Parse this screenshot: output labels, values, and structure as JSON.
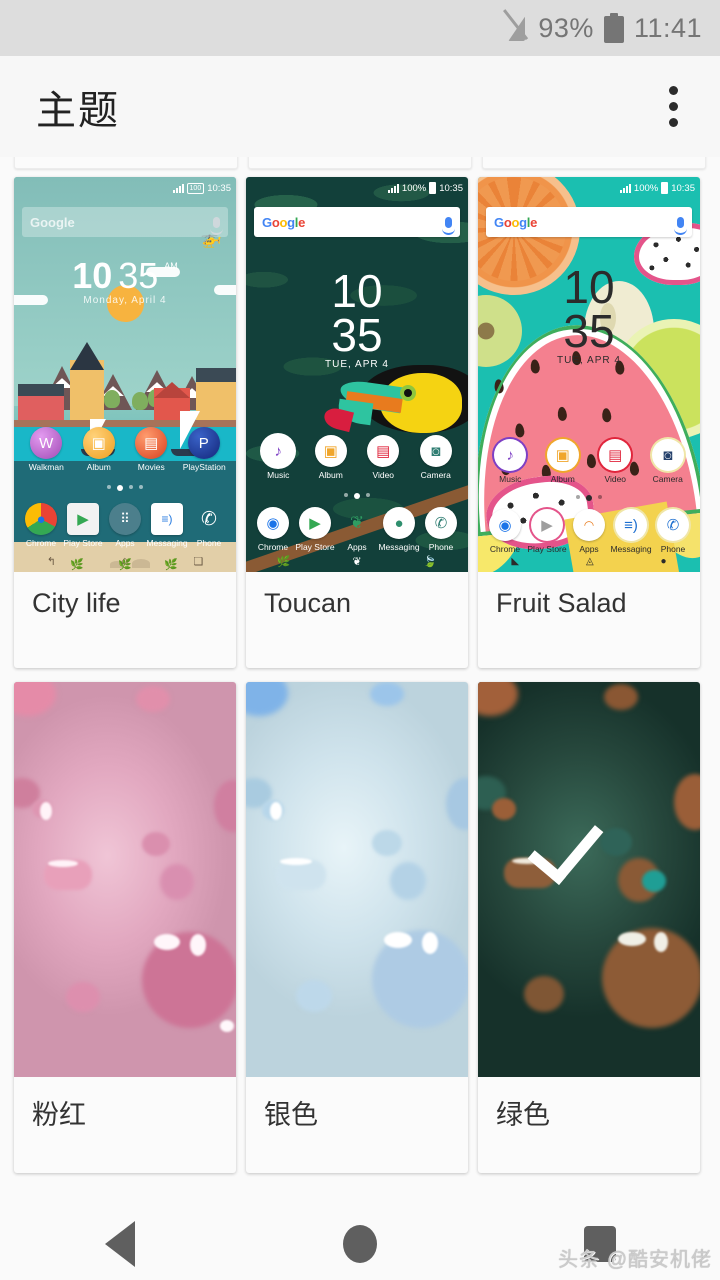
{
  "statusbar": {
    "signal_icon": "signal-off-icon",
    "battery_percent": "93%",
    "battery_icon": "battery-icon",
    "time": "11:41"
  },
  "appbar": {
    "title": "主题",
    "overflow_icon": "overflow-menu-icon"
  },
  "navbar": {
    "back_icon": "back-triangle-icon",
    "home_icon": "home-circle-icon",
    "recents_icon": "recents-square-icon"
  },
  "watermark": "头条 @酷安机佬",
  "mini_status": {
    "time": "10:35",
    "battery_text_100": "100",
    "battery_percent_100": "100%"
  },
  "themes": [
    {
      "label": "City life",
      "selected": false,
      "clock_line1": "10",
      "clock_line2": "35",
      "clock_suffix": "AM",
      "clock_date": "Monday, April 4",
      "search_hint": "Google",
      "apps_row1": [
        {
          "name": "Walkman",
          "icon": "walkman-icon",
          "glyph": "W",
          "color": "#c368c8"
        },
        {
          "name": "Album",
          "icon": "album-icon",
          "glyph": "▣",
          "color": "#f5a623"
        },
        {
          "name": "Movies",
          "icon": "movies-icon",
          "glyph": "▤",
          "color": "#e8542f"
        },
        {
          "name": "PlayStation",
          "icon": "playstation-icon",
          "glyph": "P",
          "color": "#1b3f9e"
        }
      ],
      "apps_row2": [
        {
          "name": "Chrome",
          "icon": "chrome-icon",
          "glyph": "◉",
          "color": "#ffffff"
        },
        {
          "name": "Play Store",
          "icon": "play-store-icon",
          "glyph": "▶",
          "color": "#ffffff"
        },
        {
          "name": "Apps",
          "icon": "apps-grid-icon",
          "glyph": "⠿",
          "color": "#4c7f8c"
        },
        {
          "name": "Messaging",
          "icon": "messaging-icon",
          "glyph": "≡)",
          "color": "#ffffff"
        },
        {
          "name": "Phone",
          "icon": "phone-icon",
          "glyph": "✆",
          "color": "#ffffff"
        }
      ]
    },
    {
      "label": "Toucan",
      "selected": false,
      "clock_line1": "10",
      "clock_line2": "35",
      "clock_date": "TUE, APR 4",
      "search_hint": "Google",
      "apps_row1": [
        {
          "name": "Music",
          "icon": "music-note-icon",
          "glyph": "♪",
          "color": "#7d3fc4"
        },
        {
          "name": "Album",
          "icon": "album-icon",
          "glyph": "▣",
          "color": "#f0a62c"
        },
        {
          "name": "Video",
          "icon": "video-icon",
          "glyph": "▤",
          "color": "#e0253c"
        },
        {
          "name": "Camera",
          "icon": "camera-icon",
          "glyph": "◙",
          "color": "#2f7d72"
        }
      ],
      "apps_row2": [
        {
          "name": "Chrome",
          "icon": "chrome-icon",
          "glyph": "◉",
          "color": "#ffffff"
        },
        {
          "name": "Play Store",
          "icon": "play-store-icon",
          "glyph": "▶",
          "color": "#ffffff"
        },
        {
          "name": "Apps",
          "icon": "apps-leaf-icon",
          "glyph": "❦",
          "color": "#2f7d52"
        },
        {
          "name": "Messaging",
          "icon": "messaging-icon",
          "glyph": "●",
          "color": "#2f8f6e"
        },
        {
          "name": "Phone",
          "icon": "phone-icon",
          "glyph": "✆",
          "color": "#ffffff"
        }
      ]
    },
    {
      "label": "Fruit Salad",
      "selected": false,
      "clock_line1": "10",
      "clock_line2": "35",
      "clock_date": "TUE, APR 4",
      "search_hint": "Google",
      "apps_row1": [
        {
          "name": "Music",
          "icon": "music-note-icon",
          "glyph": "♪",
          "color": "#7d3fc4"
        },
        {
          "name": "Album",
          "icon": "album-icon",
          "glyph": "▣",
          "color": "#f0a62c"
        },
        {
          "name": "Video",
          "icon": "video-icon",
          "glyph": "▤",
          "color": "#e0253c"
        },
        {
          "name": "Camera",
          "icon": "camera-icon",
          "glyph": "◙",
          "color": "#24406b"
        }
      ],
      "apps_row2": [
        {
          "name": "Chrome",
          "icon": "chrome-icon",
          "glyph": "◉",
          "color": "#ffffff"
        },
        {
          "name": "Play Store",
          "icon": "play-store-icon",
          "glyph": "▶",
          "color": "#ffffff"
        },
        {
          "name": "Apps",
          "icon": "apps-bowl-icon",
          "glyph": "🥣",
          "color": "#ffffff"
        },
        {
          "name": "Messaging",
          "icon": "messaging-icon",
          "glyph": "≡)",
          "color": "#1d6fd0"
        },
        {
          "name": "Phone",
          "icon": "phone-icon",
          "glyph": "✆",
          "color": "#1d6fd0"
        }
      ]
    },
    {
      "label": "粉红",
      "selected": false,
      "style": "droplets-pink"
    },
    {
      "label": "银色",
      "selected": false,
      "style": "droplets-silver"
    },
    {
      "label": "绿色",
      "selected": true,
      "style": "droplets-green",
      "check_icon": "check-icon"
    }
  ],
  "colors": {
    "statusbar_bg": "#dddddd",
    "appbar_bg": "#f7f7f7",
    "page_bg": "#fafafa",
    "card_bg": "#fbfbfb",
    "label_text": "#333333",
    "nav_icon": "#5f5f5f",
    "selected_check": "#ffffff",
    "theme_city_sky": "#9ed0c8",
    "theme_toucan_bg": "#12403a",
    "theme_fruit_bg": "#1bbfb0",
    "theme_pink": "#dfa7bd",
    "theme_silver": "#cfe0e8",
    "theme_green": "#21433a"
  }
}
